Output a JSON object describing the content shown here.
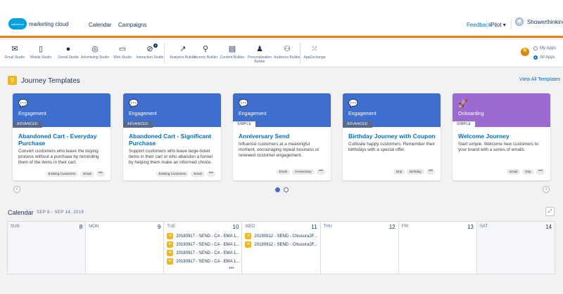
{
  "header": {
    "logo_text": "marketing cloud",
    "logo_badge": "salesforce",
    "nav": [
      {
        "label": "Calendar"
      },
      {
        "label": "Campaigns"
      }
    ],
    "feedback": "Feedback",
    "pilot": "Pilot",
    "user": "Showerthinking",
    "accent_color": "#e8820c"
  },
  "appbar": {
    "apps": [
      {
        "label": "Email Studio",
        "icon": "mail-icon"
      },
      {
        "label": "Mobile Studio",
        "icon": "mobile-icon"
      },
      {
        "label": "Social Studio",
        "icon": "social-icon"
      },
      {
        "label": "Advertising Studio",
        "icon": "target-icon"
      },
      {
        "label": "Web Studio",
        "icon": "monitor-icon"
      },
      {
        "label": "Interaction Studio",
        "icon": "compass-icon",
        "badge": "4"
      },
      {
        "label": "Analytics Builder",
        "icon": "chart-icon"
      },
      {
        "label": "Journey Builder",
        "icon": "pin-icon"
      },
      {
        "label": "Content Builder",
        "icon": "content-icon"
      },
      {
        "label": "Personalization Builder",
        "icon": "person-gear-icon"
      },
      {
        "label": "Audience Builder",
        "icon": "group-icon"
      },
      {
        "label": "AppExchange",
        "icon": "grid-icon"
      }
    ],
    "radios": [
      {
        "label": "My Apps",
        "checked": false
      },
      {
        "label": "All Apps",
        "checked": true
      }
    ]
  },
  "templates": {
    "title": "Journey Templates",
    "view_all": "View All Templates",
    "cards": [
      {
        "category": "Engagement",
        "level": "ADVANCED",
        "title": "Abandoned Cart - Everyday Purchase",
        "desc": "Convert customers who leave the buying process without a purchase by reminding them of the items in their cart.",
        "tags": [
          "Existing Customers",
          "Email"
        ]
      },
      {
        "category": "Engagement",
        "level": "ADVANCED",
        "title": "Abandoned Cart - Significant Purchase",
        "desc": "Support customers who leave large-ticket items in their cart or who abandon a funnel by helping them make an informed choice.",
        "tags": [
          "Existing Customers",
          "Email"
        ]
      },
      {
        "category": "Engagement",
        "level": "SIMPLE",
        "title": "Anniversary Send",
        "desc": "Influence customers at a meaningful moment, encouraging repeat business or renewed customer engagement.",
        "tags": [
          "Email",
          "Anniversary"
        ]
      },
      {
        "category": "Engagement",
        "level": "ADVANCED",
        "title": "Birthday Journey with Coupon",
        "desc": "Cultivate happy customers. Remember their birthdays with a special offer.",
        "tags": [
          "Drip",
          "Birthday"
        ]
      },
      {
        "category": "Onboarding",
        "level": "SIMPLE",
        "title": "Welcome Journey",
        "desc": "Start simple. Welcome new customers to your brand with a series of emails.",
        "tags": [
          "Email",
          "Drip"
        ]
      }
    ],
    "more": "•••"
  },
  "calendar": {
    "title": "Calendar",
    "range": "SEP 8 - SEP 14, 2019",
    "days": [
      {
        "name": "SUN",
        "num": "8"
      },
      {
        "name": "MON",
        "num": "9"
      },
      {
        "name": "TUE",
        "num": "10"
      },
      {
        "name": "WED",
        "num": "11"
      },
      {
        "name": "THU",
        "num": "12"
      },
      {
        "name": "FRI",
        "num": "13"
      },
      {
        "name": "SAT",
        "num": "14"
      }
    ],
    "tue_events": [
      "20190917 - SEND - CA - EMA 1...",
      "20190917 - SEND - CA - EMA 1...",
      "20190917 - SEND - CA - EMA 1...",
      "20190917 - SEND - CA - EMA 1..."
    ],
    "wed_events": [
      "20190912 - SEND - Chiusura2F...",
      "20190912 - SEND - Chiusura2F..."
    ],
    "more": "•••"
  }
}
